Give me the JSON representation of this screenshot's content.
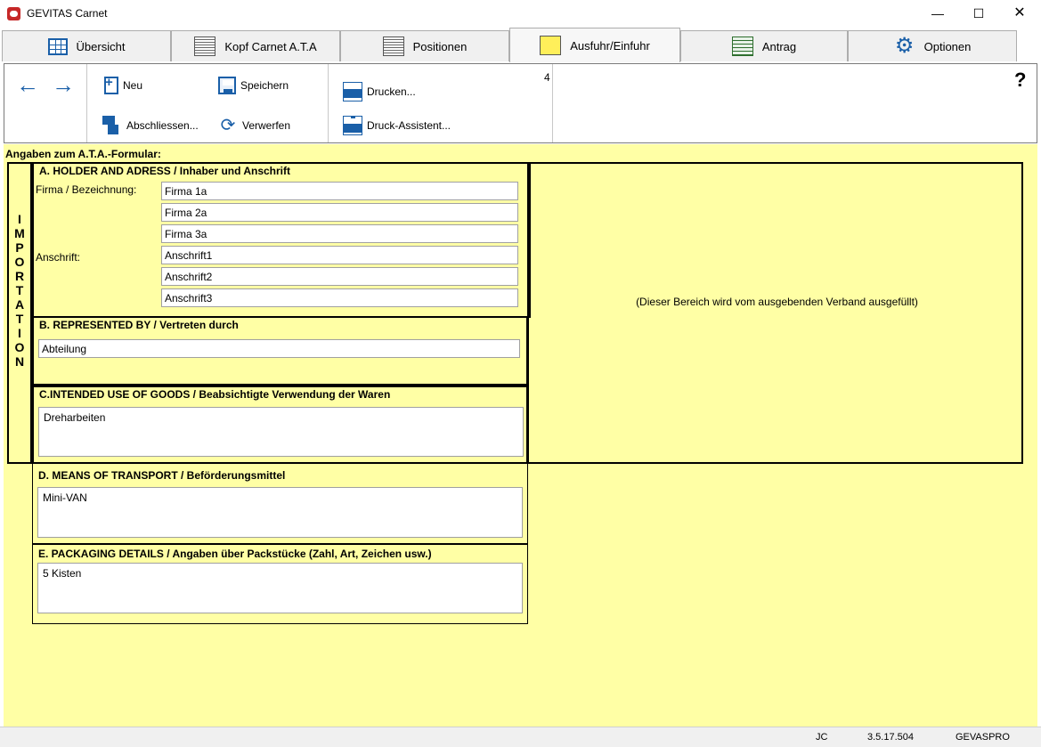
{
  "window": {
    "title": "GEVITAS Carnet",
    "minimize": "—",
    "maximize": "☐",
    "close": "✕"
  },
  "tabs": [
    {
      "label": "Übersicht",
      "icon": "table-icon"
    },
    {
      "label": "Kopf Carnet A.T.A",
      "icon": "document-icon"
    },
    {
      "label": "Positionen",
      "icon": "list-document-icon"
    },
    {
      "label": "Ausfuhr/Einfuhr",
      "icon": "note-icon",
      "active": true
    },
    {
      "label": "Antrag",
      "icon": "form-icon"
    },
    {
      "label": "Optionen",
      "icon": "gear-icon"
    }
  ],
  "toolbar": {
    "back": "←",
    "forward": "→",
    "new_label": "Neu",
    "save_label": "Speichern",
    "close_label": "Abschliessen...",
    "discard_label": "Verwerfen",
    "print_label": "Drucken...",
    "print_wizard_label": "Druck-Assistent...",
    "count": "4",
    "help": "?"
  },
  "form": {
    "caption": "Angaben zum A.T.A.-Formular:",
    "importation_letters": [
      "I",
      "M",
      "P",
      "O",
      "R",
      "T",
      "A",
      "T",
      "I",
      "O",
      "N"
    ],
    "right_note": "(Dieser Bereich wird vom ausgebenden Verband ausgefüllt)",
    "section_a": {
      "title": "A. HOLDER AND ADRESS / Inhaber und Anschrift",
      "company_label": "Firma / Bezeichnung:",
      "address_label": "Anschrift:",
      "company": [
        "Firma 1a",
        "Firma 2a",
        "Firma 3a"
      ],
      "address": [
        "Anschrift1",
        "Anschrift2",
        "Anschrift3"
      ]
    },
    "section_b": {
      "title": "B. REPRESENTED BY / Vertreten durch",
      "value": "Abteilung"
    },
    "section_c": {
      "title": "C.INTENDED USE OF GOODS / Beabsichtigte Verwendung der Waren",
      "value": "Dreharbeiten"
    },
    "section_d": {
      "title": "D. MEANS OF TRANSPORT / Beförderungsmittel",
      "value": "Mini-VAN"
    },
    "section_e": {
      "title": "E. PACKAGING DETAILS / Angaben über Packstücke (Zahl, Art, Zeichen usw.)",
      "value": "5 Kisten"
    }
  },
  "status": {
    "user": "JC",
    "version": "3.5.17.504",
    "db": "GEVASPRO"
  }
}
